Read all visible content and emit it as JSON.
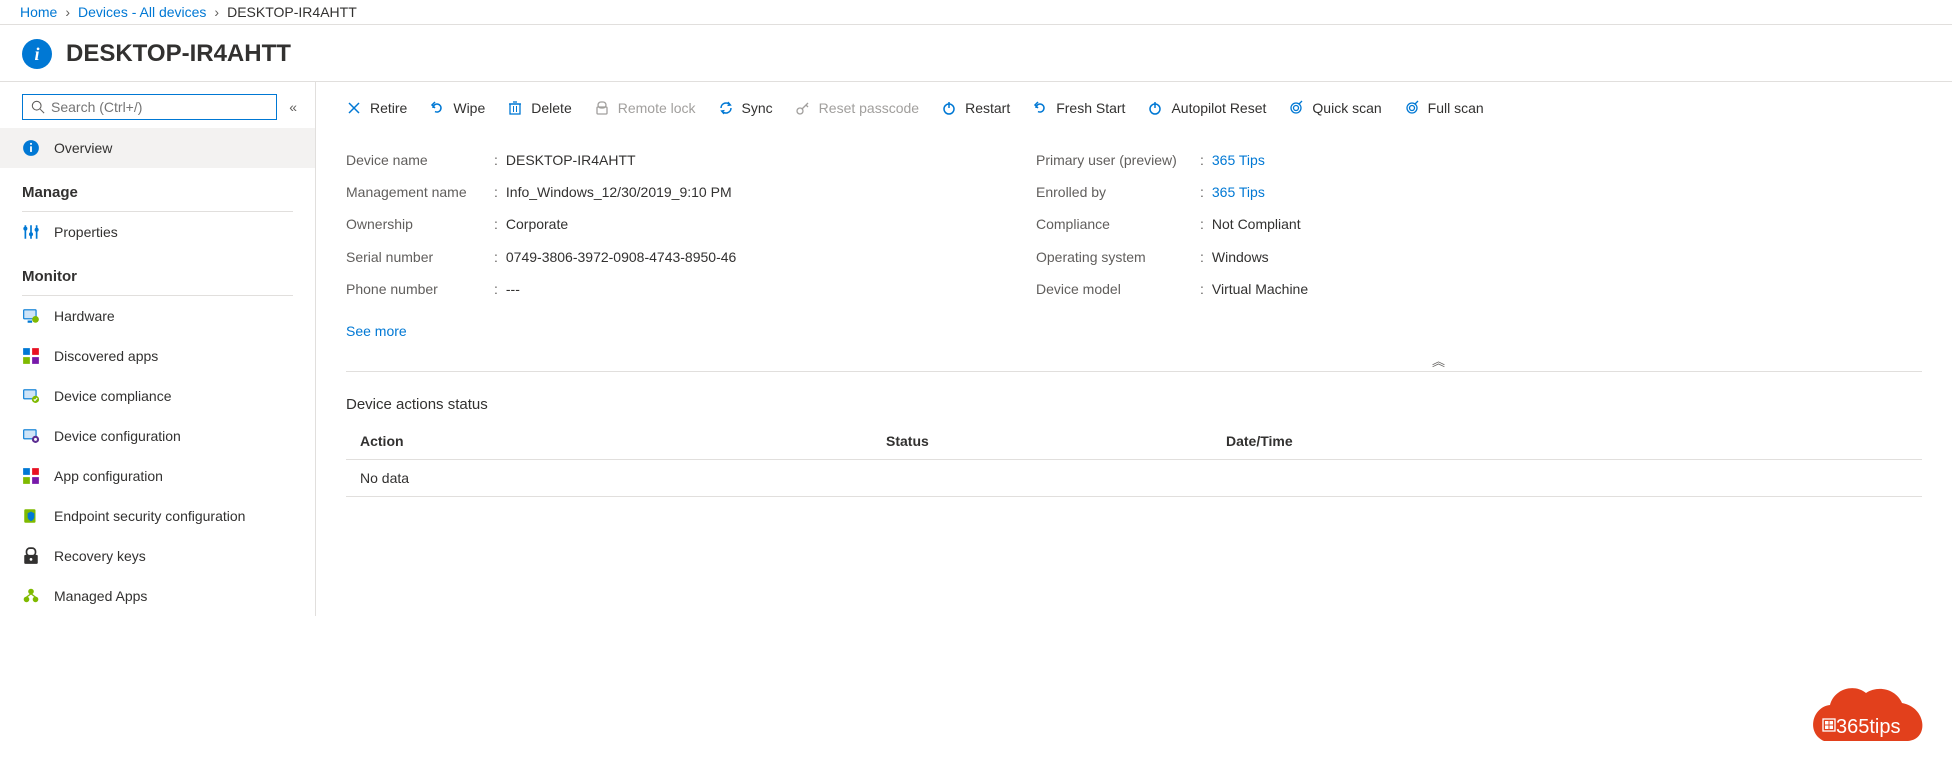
{
  "breadcrumb": {
    "items": [
      {
        "label": "Home",
        "link": true
      },
      {
        "label": "Devices - All devices",
        "link": true
      },
      {
        "label": "DESKTOP-IR4AHTT",
        "link": false
      }
    ]
  },
  "page_title": "DESKTOP-IR4AHTT",
  "search": {
    "placeholder": "Search (Ctrl+/)"
  },
  "sidebar": {
    "overview": "Overview",
    "manage_header": "Manage",
    "properties": "Properties",
    "monitor_header": "Monitor",
    "items": {
      "hardware": "Hardware",
      "discovered_apps": "Discovered apps",
      "device_compliance": "Device compliance",
      "device_configuration": "Device configuration",
      "app_configuration": "App configuration",
      "endpoint_security": "Endpoint security configuration",
      "recovery_keys": "Recovery keys",
      "managed_apps": "Managed Apps"
    }
  },
  "toolbar": {
    "retire": "Retire",
    "wipe": "Wipe",
    "delete": "Delete",
    "remote_lock": "Remote lock",
    "sync": "Sync",
    "reset_passcode": "Reset passcode",
    "restart": "Restart",
    "fresh_start": "Fresh Start",
    "autopilot_reset": "Autopilot Reset",
    "quick_scan": "Quick scan",
    "full_scan": "Full scan"
  },
  "properties_left": {
    "device_name": {
      "label": "Device name",
      "value": "DESKTOP-IR4AHTT"
    },
    "management_name": {
      "label": "Management name",
      "value": "Info_Windows_12/30/2019_9:10 PM"
    },
    "ownership": {
      "label": "Ownership",
      "value": "Corporate"
    },
    "serial_number": {
      "label": "Serial number",
      "value": "0749-3806-3972-0908-4743-8950-46"
    },
    "phone_number": {
      "label": "Phone number",
      "value": "---"
    }
  },
  "properties_right": {
    "primary_user": {
      "label": "Primary user (preview)",
      "value": "365 Tips",
      "link": true
    },
    "enrolled_by": {
      "label": "Enrolled by",
      "value": "365 Tips",
      "link": true
    },
    "compliance": {
      "label": "Compliance",
      "value": "Not Compliant"
    },
    "operating_system": {
      "label": "Operating system",
      "value": "Windows"
    },
    "device_model": {
      "label": "Device model",
      "value": "Virtual Machine"
    }
  },
  "see_more": "See more",
  "actions": {
    "title": "Device actions status",
    "col_action": "Action",
    "col_status": "Status",
    "col_datetime": "Date/Time",
    "no_data": "No data"
  },
  "badge_text": "365tips"
}
